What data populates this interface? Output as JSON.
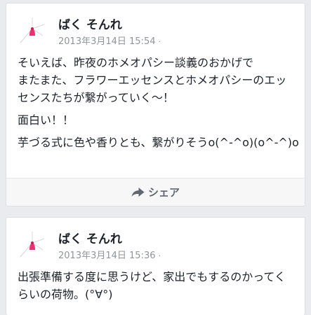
{
  "posts": [
    {
      "author": "ばく そんれ",
      "timestamp": "2013年3月14日 15:54",
      "privacy_icon": "dot",
      "paragraphs": [
        "そいえば、昨夜のホメオパシー談義のおかげで",
        "またまた、フラワーエッセンスとホメオパシーのエッ",
        "センスたちが繋がっていく〜！",
        "面白い！！",
        "芋づる式に色や香りとも、繋がりそうo(^-^o)(o^-^)o"
      ],
      "share_label": "シェア",
      "share_icon": "share-arrow-icon"
    },
    {
      "author": "ばく そんれ",
      "timestamp": "2013年3月14日 15:36",
      "privacy_icon": "dot",
      "paragraphs": [
        "出張準備する度に思うけど、家出でもするのかってく",
        "らいの荷物。(°∀°)"
      ]
    }
  ],
  "colors": {
    "background": "#e9ebee",
    "card": "#ffffff",
    "text": "#1d2129",
    "meta": "#90949c",
    "action": "#606770",
    "avatar_accent": "#e8336e"
  }
}
